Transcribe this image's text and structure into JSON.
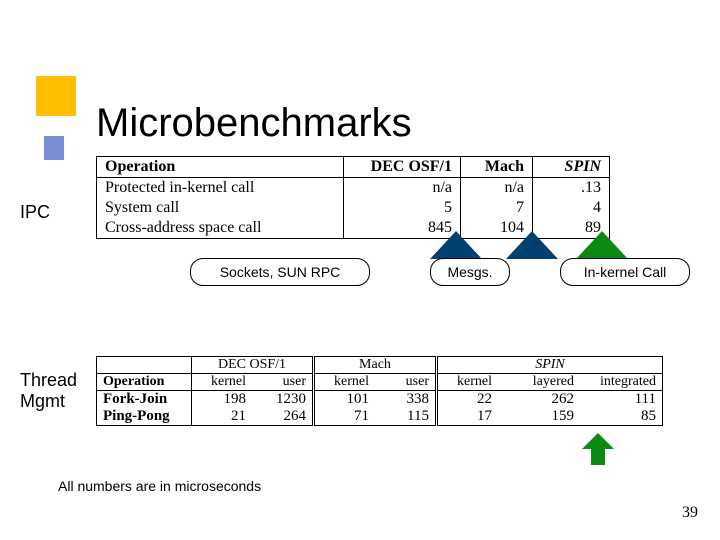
{
  "title": "Microbenchmarks",
  "labels": {
    "ipc": "IPC",
    "thread": "Thread\nMgmt"
  },
  "ipc_table": {
    "headers": [
      "Operation",
      "DEC OSF/1",
      "Mach",
      "SPIN"
    ],
    "rows": [
      {
        "op": "Protected in-kernel call",
        "a": "n/a",
        "b": "n/a",
        "c": ".13"
      },
      {
        "op": "System call",
        "a": "5",
        "b": "7",
        "c": "4"
      },
      {
        "op": "Cross-address space call",
        "a": "845",
        "b": "104",
        "c": "89"
      }
    ]
  },
  "annotations": {
    "sockets": "Sockets, SUN RPC",
    "mesgs": "Mesgs.",
    "inkernel": "In-kernel Call"
  },
  "thread_table": {
    "group_headers": [
      "DEC OSF/1",
      "Mach",
      "SPIN"
    ],
    "sub_headers": {
      "op": "Operation",
      "kernel": "kernel",
      "user": "user",
      "layered": "layered",
      "integrated": "integrated"
    },
    "rows": [
      {
        "op": "Fork-Join",
        "dec_k": "198",
        "dec_u": "1230",
        "mach_k": "101",
        "mach_u": "338",
        "spin_k": "22",
        "spin_l": "262",
        "spin_i": "111"
      },
      {
        "op": "Ping-Pong",
        "dec_k": "21",
        "dec_u": "264",
        "mach_k": "71",
        "mach_u": "115",
        "spin_k": "17",
        "spin_l": "159",
        "spin_i": "85"
      }
    ]
  },
  "footnote": "All numbers are in microseconds",
  "page_number": "39"
}
